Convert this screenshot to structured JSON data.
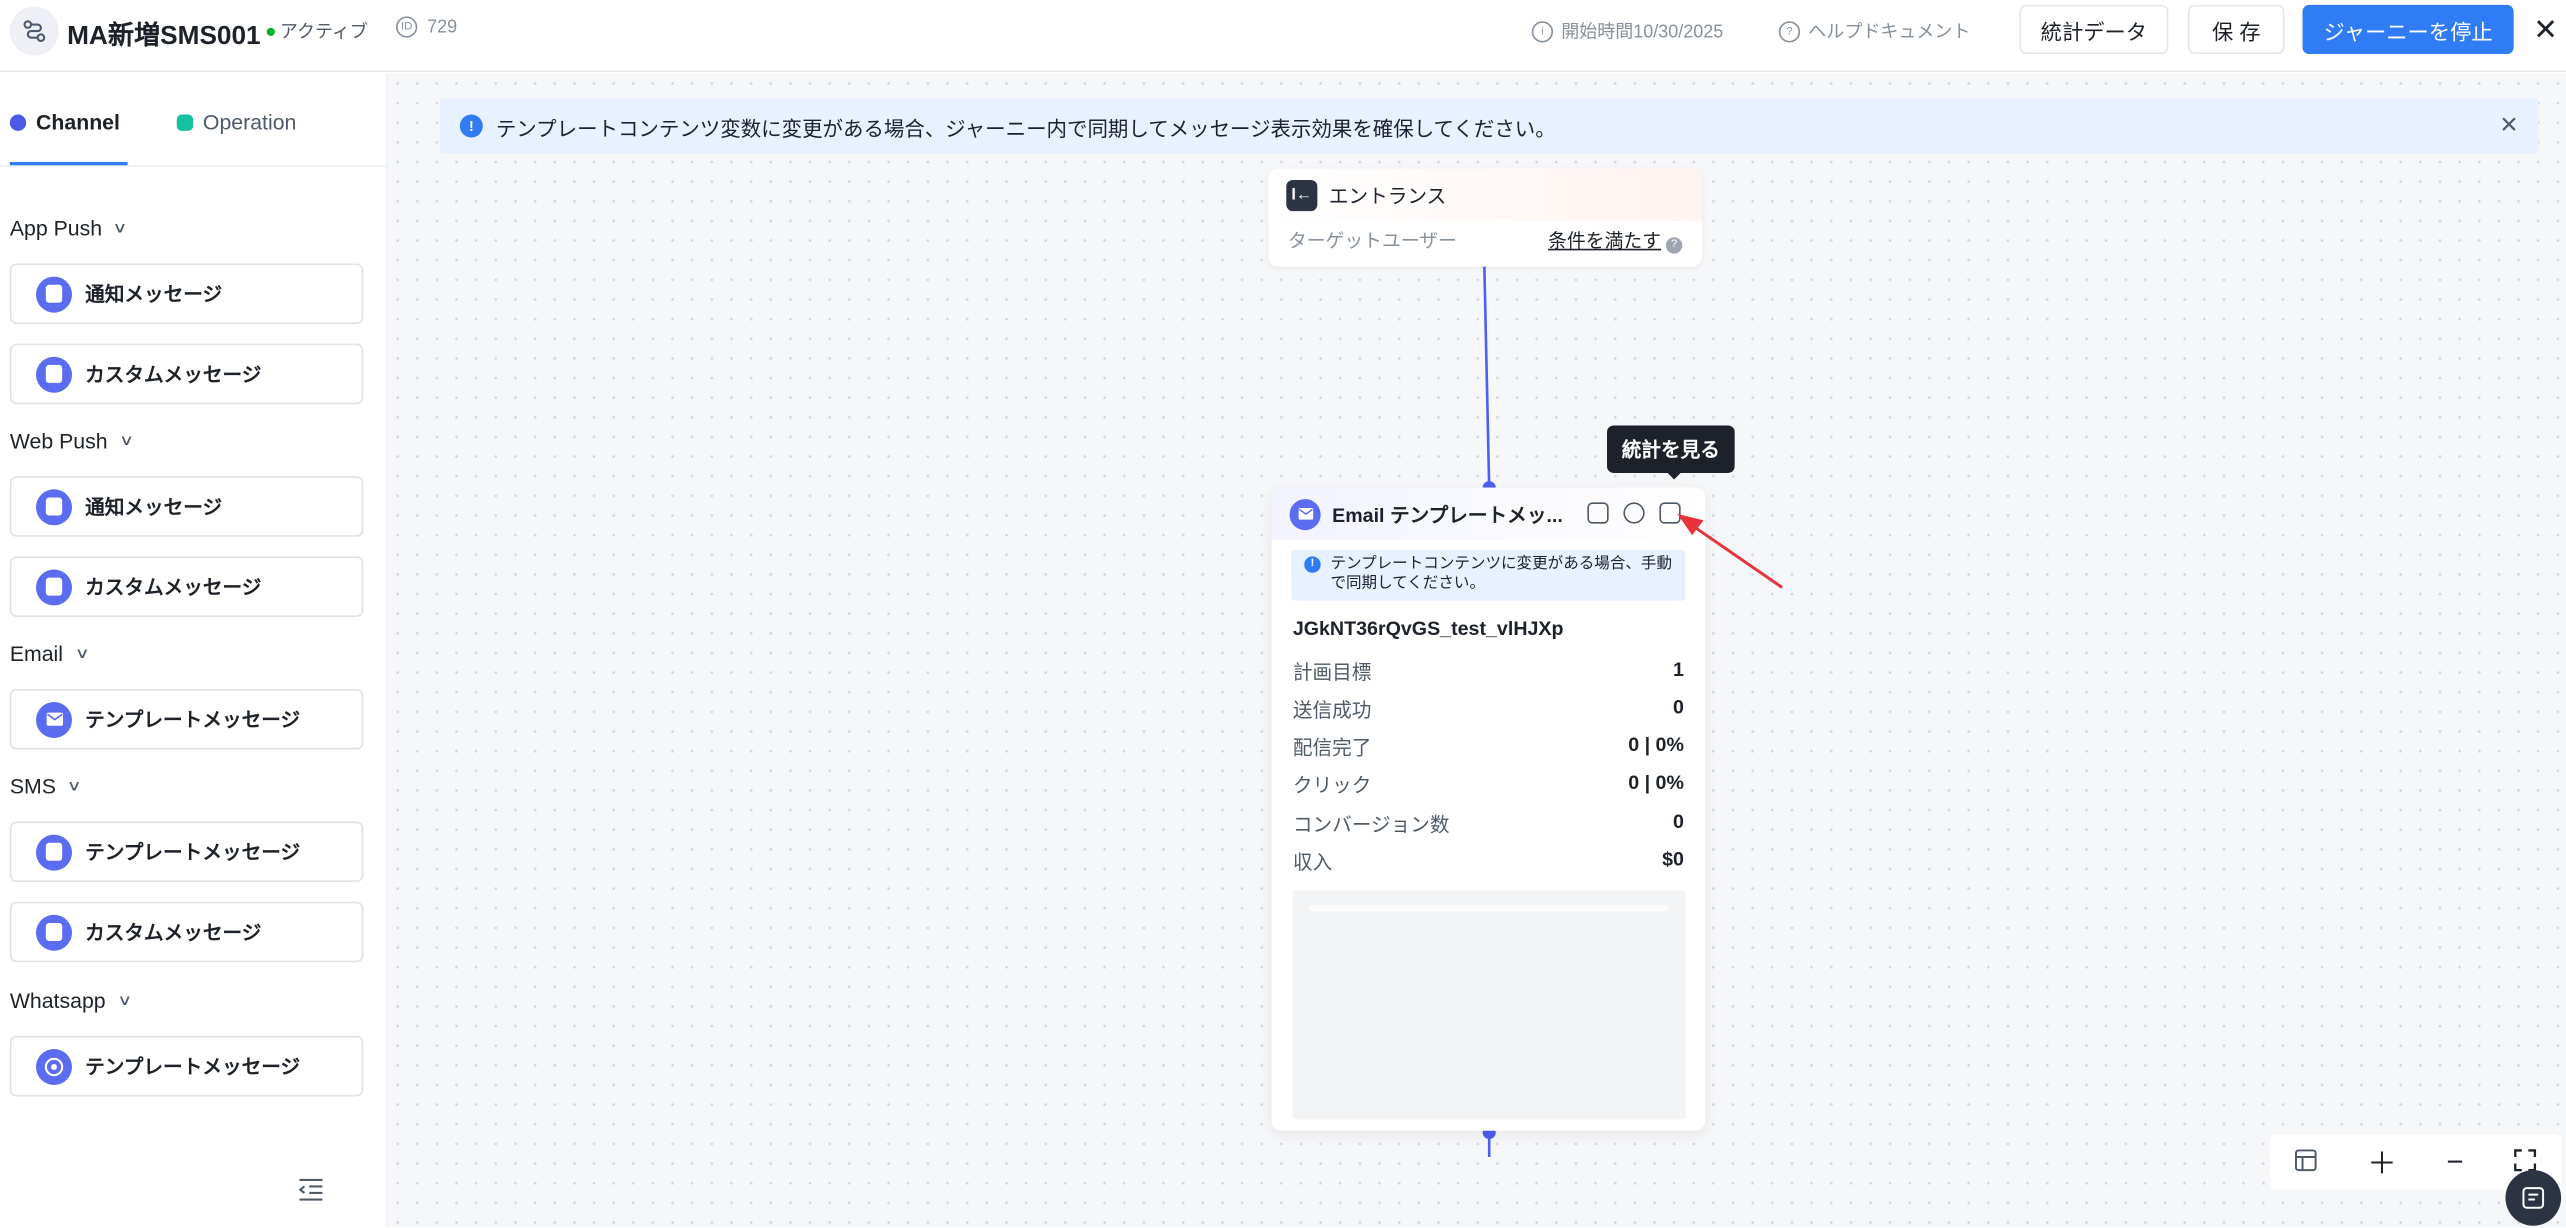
{
  "header": {
    "title": "MA新増SMS001",
    "status": "アクティブ",
    "id_value": "729",
    "id_icon": "id-icon",
    "start_time": "開始時間10/30/2025",
    "help_doc": "ヘルプドキュメント",
    "stats_button": "統計データ",
    "save_button": "保 存",
    "stop_button": "ジャーニーを停止",
    "close_glyph": "✕"
  },
  "sidebar": {
    "tabs": [
      {
        "label": "Channel",
        "color": "#4a59e6"
      },
      {
        "label": "Operation",
        "color": "#16c1a0"
      }
    ],
    "groups": [
      {
        "name": "App Push",
        "items": [
          "通知メッセージ",
          "カスタムメッセージ"
        ]
      },
      {
        "name": "Web Push",
        "items": [
          "通知メッセージ",
          "カスタムメッセージ"
        ]
      },
      {
        "name": "Email",
        "items": [
          "テンプレートメッセージ"
        ]
      },
      {
        "name": "SMS",
        "items": [
          "テンプレートメッセージ",
          "カスタムメッセージ"
        ]
      },
      {
        "name": "Whatsapp",
        "items": [
          "テンプレートメッセージ"
        ]
      }
    ]
  },
  "canvas": {
    "banner": "テンプレートコンテンツ変数に変更がある場合、ジャーニー内で同期してメッセージ表示効果を確保してください。",
    "entrance": {
      "title": "エントランス",
      "target_label": "ターゲットユーザー",
      "condition": "条件を満たす"
    },
    "tooltip": "統計を見る",
    "email_node": {
      "title": "Email テンプレートメッ...",
      "note": "テンプレートコンテンツに変更がある場合、手動で同期してください。",
      "template_name": "JGkNT36rQvGS_test_vlHJXp",
      "stats": [
        {
          "label": "計画目標",
          "value": "1"
        },
        {
          "label": "送信成功",
          "value": "0"
        },
        {
          "label": "配信完了",
          "value": "0 | 0%"
        },
        {
          "label": "クリック",
          "value": "0 | 0%"
        },
        {
          "label": "コンバージョン数",
          "value": "0"
        },
        {
          "label": "収入",
          "value": "$0"
        }
      ]
    }
  },
  "colors": {
    "primary": "#2f7cf6",
    "connector": "#4f5ff0",
    "arrow": "#e8323c",
    "node_icon": "#5b6cf0"
  }
}
